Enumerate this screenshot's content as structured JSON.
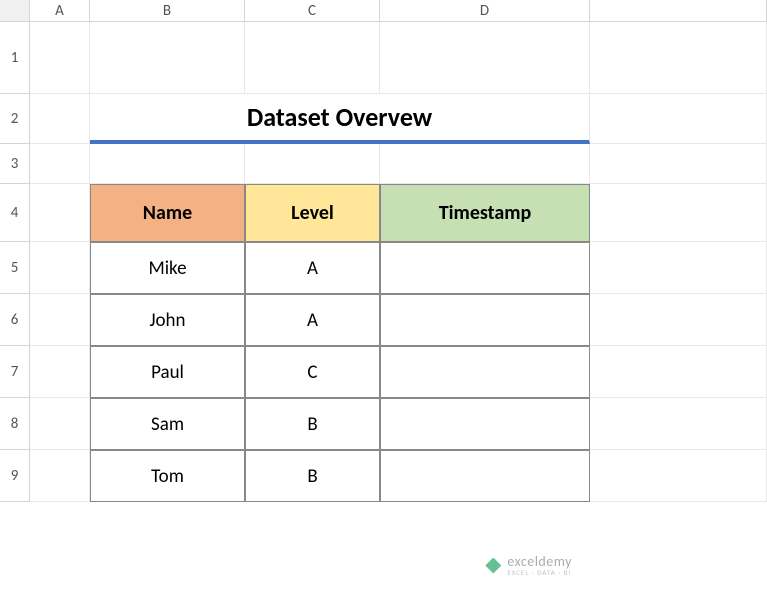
{
  "columns": {
    "A": "A",
    "B": "B",
    "C": "C",
    "D": "D"
  },
  "rows": {
    "1": "1",
    "2": "2",
    "3": "3",
    "4": "4",
    "5": "5",
    "6": "6",
    "7": "7",
    "8": "8",
    "9": "9"
  },
  "title": "Dataset Overvew",
  "headers": {
    "name": "Name",
    "level": "Level",
    "timestamp": "Timestamp"
  },
  "data": [
    {
      "name": "Mike",
      "level": "A",
      "timestamp": ""
    },
    {
      "name": "John",
      "level": "A",
      "timestamp": ""
    },
    {
      "name": "Paul",
      "level": "C",
      "timestamp": ""
    },
    {
      "name": "Sam",
      "level": "B",
      "timestamp": ""
    },
    {
      "name": "Tom",
      "level": "B",
      "timestamp": ""
    }
  ],
  "watermark": {
    "brand": "exceldemy",
    "tagline": "EXCEL · DATA · BI"
  },
  "colors": {
    "title_underline": "#4472c4",
    "name_header_bg": "#f4b183",
    "level_header_bg": "#ffe699",
    "timestamp_header_bg": "#c6e0b4"
  }
}
